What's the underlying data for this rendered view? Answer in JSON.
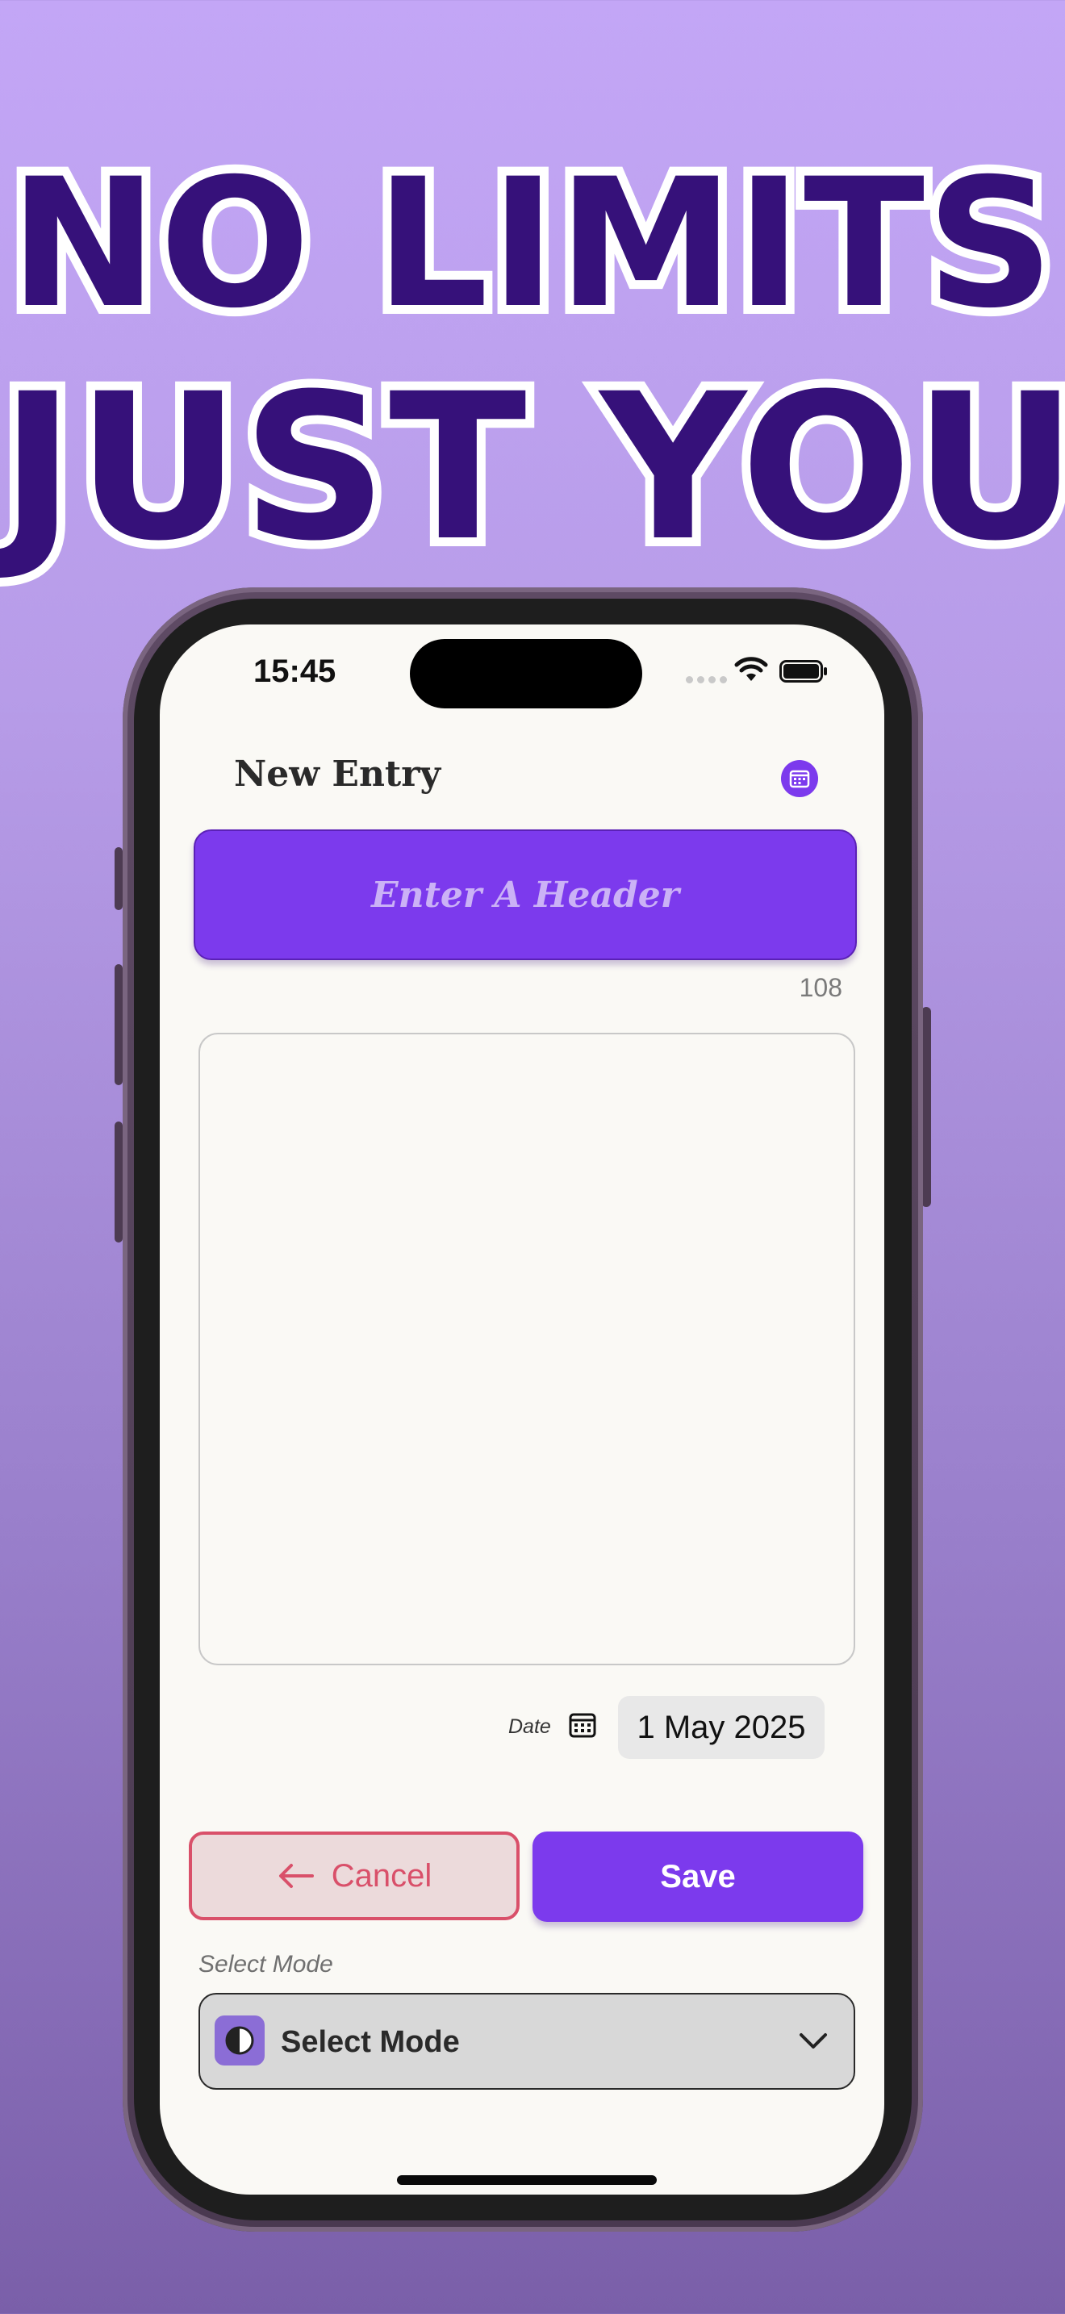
{
  "headline": {
    "line1": "NO LIMITS",
    "line2": "JUST YOU"
  },
  "status_bar": {
    "time": "15:45"
  },
  "app": {
    "title": "New Entry",
    "header_placeholder": "Enter A Header",
    "char_count": "108",
    "date_label": "Date",
    "date_value": "1 May 2025",
    "cancel_label": "Cancel",
    "save_label": "Save",
    "mode_label": "Select Mode",
    "mode_value": "Select Mode"
  },
  "colors": {
    "accent": "#7c3aed",
    "headline": "#36117a",
    "cancel": "#d9506a"
  },
  "icons": {
    "calendar": "calendar-icon",
    "back_arrow": "arrow-left-icon",
    "mode": "contrast-icon",
    "dropdown": "chevron-down-icon"
  }
}
